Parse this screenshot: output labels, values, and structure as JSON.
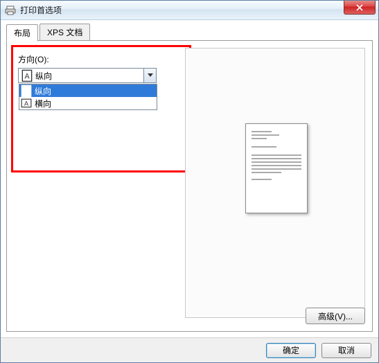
{
  "window": {
    "title": "打印首选项"
  },
  "tabs": {
    "layout": "布局",
    "xps": "XPS 文档"
  },
  "orientation": {
    "label": "方向(O):",
    "selected": "纵向",
    "options": {
      "portrait": "纵向",
      "landscape": "横向"
    }
  },
  "buttons": {
    "advanced": "高级(V)...",
    "ok": "确定",
    "cancel": "取消"
  }
}
